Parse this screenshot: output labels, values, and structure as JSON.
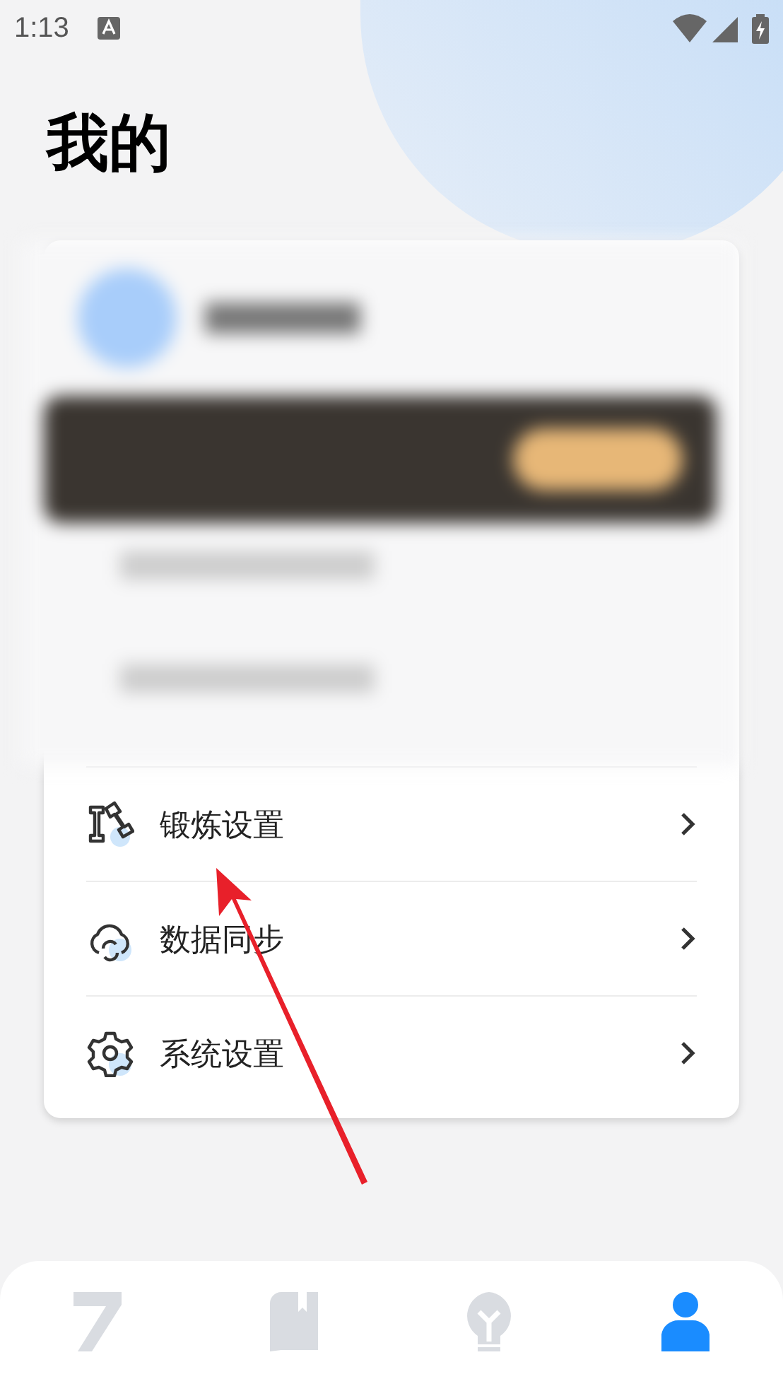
{
  "status_bar": {
    "time": "1:13"
  },
  "title": "我的",
  "menu": [
    {
      "kind": "dumbbell",
      "label": "锻炼设置"
    },
    {
      "kind": "cloud",
      "label": "数据同步"
    },
    {
      "kind": "gear",
      "label": "系统设置"
    }
  ],
  "tabs": [
    {
      "kind": "seven",
      "selected": false
    },
    {
      "kind": "book",
      "selected": false
    },
    {
      "kind": "bulb",
      "selected": false
    },
    {
      "kind": "person",
      "selected": true
    }
  ]
}
